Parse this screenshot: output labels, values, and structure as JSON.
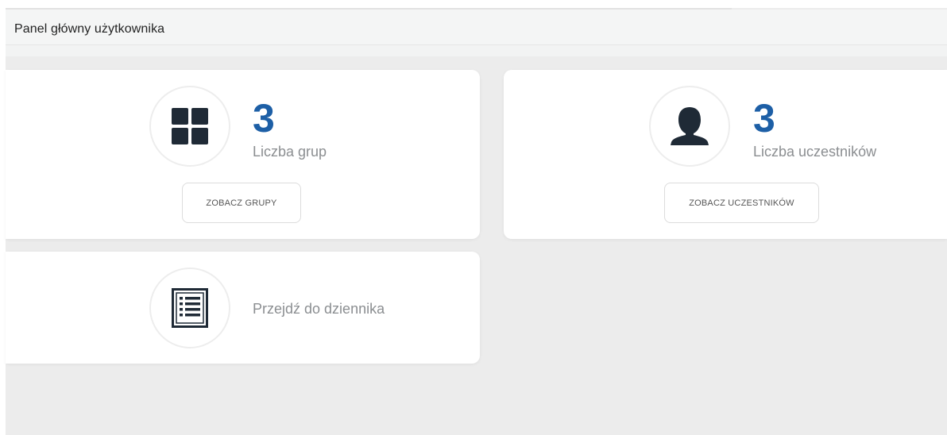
{
  "header": {
    "title": "Panel główny użytkownika"
  },
  "cards": {
    "groups": {
      "icon": "grid-icon",
      "count": "3",
      "label": "Liczba grup",
      "button_label": "ZOBACZ GRUPY"
    },
    "participants": {
      "icon": "user-icon",
      "count": "3",
      "label": "Liczba uczestników",
      "button_label": "ZOBACZ UCZESTNIKÓW"
    },
    "journal": {
      "icon": "list-icon",
      "label": "Przejdź do dziennika"
    }
  },
  "colors": {
    "accent": "#1d5fa6",
    "icon": "#1f2a36",
    "background": "#ececec",
    "card": "#ffffff"
  }
}
